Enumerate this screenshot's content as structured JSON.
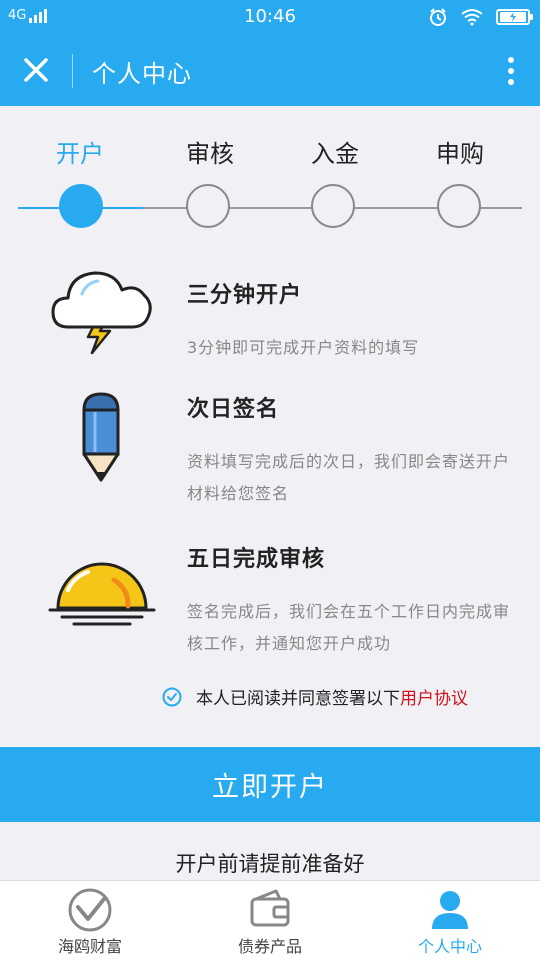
{
  "status_bar": {
    "network": "4G",
    "time": "10:46"
  },
  "nav": {
    "title": "个人中心"
  },
  "steps": [
    {
      "label": "开户",
      "active": true
    },
    {
      "label": "审核",
      "active": false
    },
    {
      "label": "入金",
      "active": false
    },
    {
      "label": "申购",
      "active": false
    }
  ],
  "features": [
    {
      "title": "三分钟开户",
      "desc": "3分钟即可完成开户资料的填写"
    },
    {
      "title": "次日签名",
      "desc": "资料填写完成后的次日，我们即会寄送开户材料给您签名"
    },
    {
      "title": "五日完成审核",
      "desc": "签名完成后，我们会在五个工作日内完成审核工作，并通知您开户成功"
    }
  ],
  "agreement": {
    "text": "本人已阅读并同意签署以下",
    "link": "用户协议"
  },
  "open_button": "立即开户",
  "prepare_text": "开户前请提前准备好",
  "tabs": [
    {
      "label": "海鸥财富"
    },
    {
      "label": "债券产品"
    },
    {
      "label": "个人中心"
    }
  ],
  "colors": {
    "accent": "#27aaf0",
    "link": "#d0121b",
    "background": "#f0f0f5"
  }
}
